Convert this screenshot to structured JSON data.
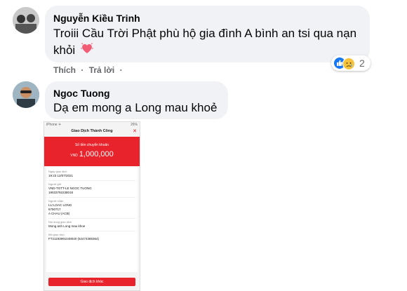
{
  "comments": [
    {
      "author": "Nguyễn Kiều Trinh",
      "text_line1": "Troiii Cầu Trời Phật phù hộ gia đình A bình an tsi qua nạn",
      "text_line2": "khỏi",
      "actions": {
        "like": "Thích",
        "dot1": "·",
        "reply": "Trả lời",
        "dot2": "·"
      },
      "reactions": {
        "count": "2",
        "icons": [
          "like-icon",
          "sad-icon"
        ]
      }
    },
    {
      "author": "Ngoc Tuong",
      "text": "Dạ em mong a Long mau khoẻ",
      "attachment": {
        "status_left": "iPhone ✈",
        "status_right": "26%",
        "title": "Giao Dịch Thành Công",
        "amount_label": "Số tiền chuyển khoản",
        "currency": "VND",
        "amount": "1,000,000",
        "fields": [
          {
            "label": "Ngày giao dịch",
            "value": "19:23 12/07/2021"
          },
          {
            "label": "Người gửi",
            "value": "VND-TGTT-LE NGOC TUONG",
            "value2": "19033792238018"
          },
          {
            "label": "Người nhận",
            "value": "LU LOAC LONG",
            "value2": "6750717",
            "value3": "A CHAU (ACB)"
          },
          {
            "label": "Nội dung giao dịch",
            "value": "Mong anh Long mau khoe"
          },
          {
            "label": "Mã giao dịch",
            "value": "FT21193991048040 (52474385364)"
          }
        ],
        "button": "Giao dịch khác"
      }
    }
  ],
  "colors": {
    "bubble": "#f0f2f5",
    "meta": "#65676b",
    "like": "#1877f2",
    "bank_red": "#e8232b"
  }
}
